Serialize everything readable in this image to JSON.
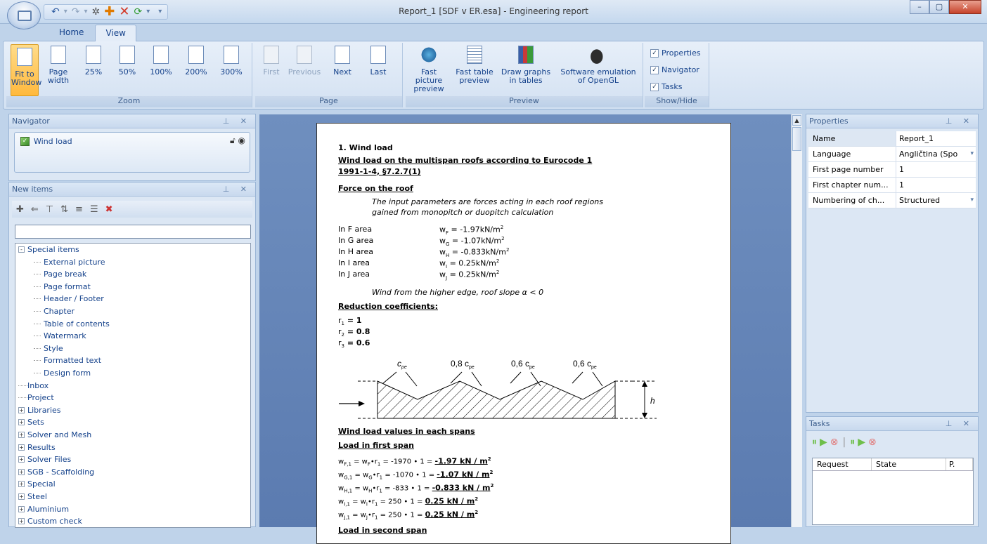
{
  "window": {
    "title": "Report_1 [SDF v ER.esa] - Engineering report",
    "minimize": "–",
    "maximize": "▢",
    "close": "✕"
  },
  "qat": {
    "icons": [
      "undo-icon",
      "redo-icon",
      "gear-icon",
      "add-icon",
      "delete-icon",
      "refresh-icon",
      "dropdown-icon"
    ]
  },
  "tabs": [
    "Home",
    "View"
  ],
  "ribbon": {
    "zoom": {
      "label": "Zoom",
      "buttons": [
        "Fit to Window",
        "Page width",
        "25%",
        "50%",
        "100%",
        "200%",
        "300%"
      ]
    },
    "page": {
      "label": "Page",
      "buttons": [
        "First",
        "Previous",
        "Next",
        "Last"
      ]
    },
    "preview": {
      "label": "Preview",
      "buttons": [
        "Fast picture preview",
        "Fast table preview",
        "Draw graphs in tables",
        "Software emulation of OpenGL"
      ]
    },
    "showhide": {
      "label": "Show/Hide",
      "checks": [
        "Properties",
        "Navigator",
        "Tasks"
      ]
    }
  },
  "navigator": {
    "title": "Navigator",
    "item": "Wind load"
  },
  "newitems": {
    "title": "New items",
    "search_value": "",
    "tree": [
      {
        "label": "Special items",
        "level": 0,
        "expander": "-"
      },
      {
        "label": "External picture",
        "level": 1
      },
      {
        "label": "Page break",
        "level": 1
      },
      {
        "label": "Page format",
        "level": 1
      },
      {
        "label": "Header / Footer",
        "level": 1
      },
      {
        "label": "Chapter",
        "level": 1
      },
      {
        "label": "Table of contents",
        "level": 1
      },
      {
        "label": "Watermark",
        "level": 1
      },
      {
        "label": "Style",
        "level": 1
      },
      {
        "label": "Formatted text",
        "level": 1
      },
      {
        "label": "Design form",
        "level": 1
      },
      {
        "label": "Inbox",
        "level": 0
      },
      {
        "label": "Project",
        "level": 0
      },
      {
        "label": "Libraries",
        "level": 0,
        "expander": "+"
      },
      {
        "label": "Sets",
        "level": 0,
        "expander": "+"
      },
      {
        "label": "Solver and Mesh",
        "level": 0,
        "expander": "+"
      },
      {
        "label": "Results",
        "level": 0,
        "expander": "+"
      },
      {
        "label": "Solver Files",
        "level": 0,
        "expander": "+"
      },
      {
        "label": "SGB - Scaffolding",
        "level": 0,
        "expander": "+"
      },
      {
        "label": "Special",
        "level": 0,
        "expander": "+"
      },
      {
        "label": "Steel",
        "level": 0,
        "expander": "+"
      },
      {
        "label": "Aluminium",
        "level": 0,
        "expander": "+"
      },
      {
        "label": "Custom check",
        "level": 0,
        "expander": "+"
      }
    ]
  },
  "doc": {
    "h1": "1. Wind load",
    "h2a": "Wind load on the multispan roofs according to Eurocode 1",
    "h2b": "1991-1-4, §7.2.7(1)",
    "force": "Force on the roof",
    "intro1": "The input parameters are forces acting in each roof regions",
    "intro2": "gained from monopitch or duopitch calculation",
    "areas": [
      {
        "name": "In F area",
        "sym": "w",
        "sub": "F",
        "val": " = -1.97kN/m",
        "sup": "2"
      },
      {
        "name": "In G area",
        "sym": "w",
        "sub": "G",
        "val": " = -1.07kN/m",
        "sup": "2"
      },
      {
        "name": "In H area",
        "sym": "w",
        "sub": "H",
        "val": " = -0.833kN/m",
        "sup": "2"
      },
      {
        "name": "In I area",
        "sym": "w",
        "sub": "I",
        "val": " = 0.25kN/m",
        "sup": "2"
      },
      {
        "name": "In J area",
        "sym": "w",
        "sub": "J",
        "val": " = 0.25kN/m",
        "sup": "2"
      }
    ],
    "windnote": "Wind from  the higher edge, roof slope α < 0",
    "reduction": "Reduction coefficients:",
    "coefs": [
      {
        "n": "r",
        "s": "1",
        "v": " = 1"
      },
      {
        "n": "r",
        "s": "2",
        "v": " = 0.8"
      },
      {
        "n": "r",
        "s": "3",
        "v": " = 0.6"
      }
    ],
    "fig": {
      "c1": "c",
      "c1s": "pe",
      "c2": "0,8 c",
      "c2s": "pe",
      "c3": "0,6 c",
      "c3s": "pe",
      "c4": "0,6 c",
      "c4s": "pe",
      "h": "h"
    },
    "values_title": "Wind load values in each spans",
    "first_span": "Load in first span",
    "lines": [
      {
        "l": "w",
        "ls": "F,1",
        "m": " = w",
        "ms": "F",
        "r": "•r",
        "rs": "1",
        "t": " = -1970 • 1 = ",
        "res": "-1.97 kN / m",
        "sup": "2"
      },
      {
        "l": "w",
        "ls": "G,1",
        "m": " = w",
        "ms": "G",
        "r": "•r",
        "rs": "1",
        "t": " = -1070 • 1 = ",
        "res": "-1.07 kN / m",
        "sup": "2"
      },
      {
        "l": "w",
        "ls": "H,1",
        "m": " = w",
        "ms": "H",
        "r": "•r",
        "rs": "1",
        "t": " = -833 • 1 = ",
        "res": "-0.833 kN / m",
        "sup": "2"
      },
      {
        "l": "w",
        "ls": "I,1",
        "m": " = w",
        "ms": "I",
        "r": "•r",
        "rs": "1",
        "t": " = 250 • 1 = ",
        "res": "0.25 kN / m",
        "sup": "2"
      },
      {
        "l": "w",
        "ls": "J,1",
        "m": " = w",
        "ms": "J",
        "r": "•r",
        "rs": "1",
        "t": " = 250 • 1 = ",
        "res": "0.25 kN / m",
        "sup": "2"
      }
    ],
    "second_span": "Load in second span"
  },
  "properties": {
    "title": "Properties",
    "rows": [
      {
        "k": "Name",
        "v": "Report_1"
      },
      {
        "k": "Language",
        "v": "Angličtina (Spo",
        "dd": true
      },
      {
        "k": "First page number",
        "v": "1"
      },
      {
        "k": "First chapter num...",
        "v": "1"
      },
      {
        "k": "Numbering of ch...",
        "v": "Structured",
        "dd": true
      }
    ]
  },
  "tasks": {
    "title": "Tasks",
    "cols": [
      "Request",
      "State",
      "P."
    ]
  },
  "pin": "⊥ ✕"
}
